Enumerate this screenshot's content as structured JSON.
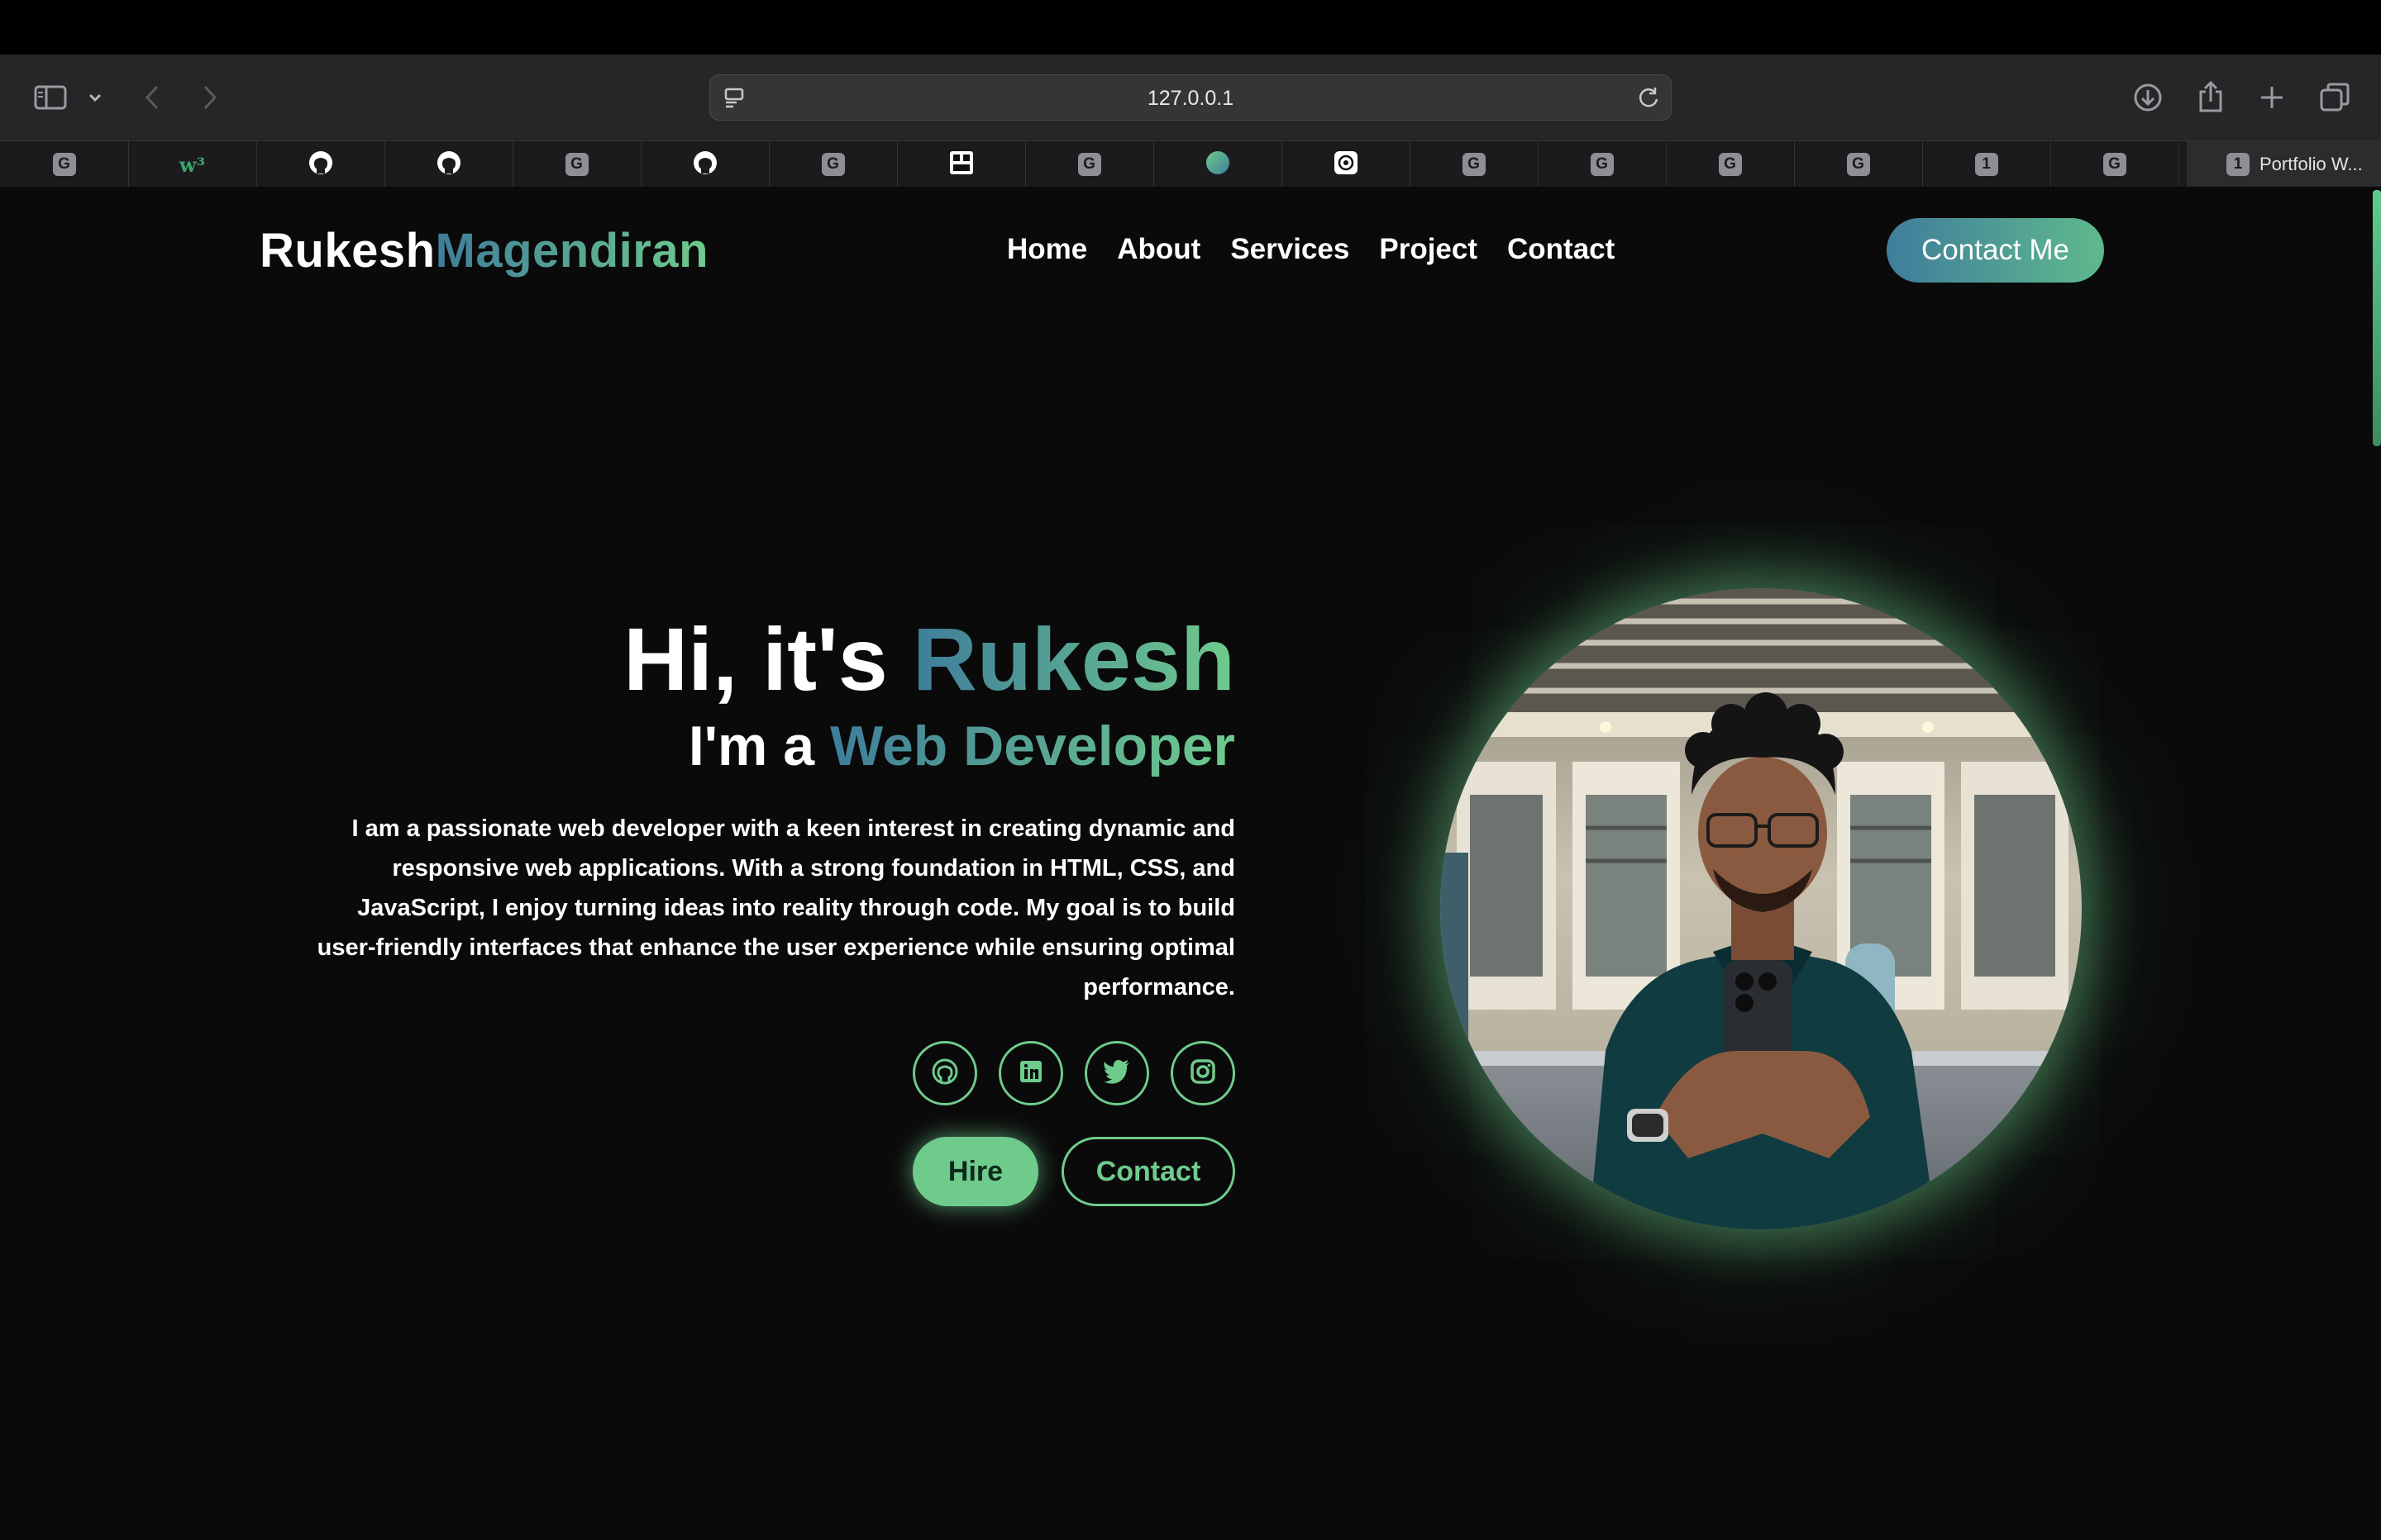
{
  "browser": {
    "url": "127.0.0.1",
    "tabs": [
      {
        "icon": "google-favicon",
        "glyph": "G"
      },
      {
        "icon": "w3schools-favicon",
        "glyph": "w³"
      },
      {
        "icon": "github-favicon",
        "glyph": ""
      },
      {
        "icon": "github-favicon",
        "glyph": ""
      },
      {
        "icon": "google-favicon",
        "glyph": "G"
      },
      {
        "icon": "github-favicon",
        "glyph": ""
      },
      {
        "icon": "google-favicon",
        "glyph": "G"
      },
      {
        "icon": "pattern-favicon",
        "glyph": ""
      },
      {
        "icon": "google-favicon",
        "glyph": "G"
      },
      {
        "icon": "gradient-circle-favicon",
        "glyph": ""
      },
      {
        "icon": "openai-favicon",
        "glyph": ""
      },
      {
        "icon": "google-favicon",
        "glyph": "G"
      },
      {
        "icon": "google-favicon",
        "glyph": "G"
      },
      {
        "icon": "google-favicon",
        "glyph": "G"
      },
      {
        "icon": "google-favicon",
        "glyph": "G"
      },
      {
        "icon": "number-favicon",
        "glyph": "1"
      },
      {
        "icon": "google-favicon",
        "glyph": "G"
      }
    ],
    "active_tab": {
      "icon_glyph": "1",
      "title": "Portfolio W..."
    }
  },
  "site": {
    "logo_first": "Rukesh",
    "logo_last": "Magendiran",
    "nav": [
      "Home",
      "About",
      "Services",
      "Project",
      "Contact"
    ],
    "cta_label": "Contact Me"
  },
  "hero": {
    "greeting": "Hi, it's",
    "name": "Rukesh",
    "role_prefix": "I'm a",
    "role": "Web Developer",
    "description": "I am a passionate web developer with a keen interest in creating dynamic and responsive web applications. With a strong foundation in HTML, CSS, and JavaScript, I enjoy turning ideas into reality through code. My goal is to build user-friendly interfaces that enhance the user experience while ensuring optimal performance.",
    "socials": [
      "github-icon",
      "linkedin-icon",
      "twitter-icon",
      "instagram-icon"
    ],
    "hire_label": "Hire",
    "contact_label": "Contact"
  },
  "colors": {
    "accent_green": "#6fcb8c",
    "accent_blue": "#3f7d9b",
    "background": "#0a0a0a"
  }
}
